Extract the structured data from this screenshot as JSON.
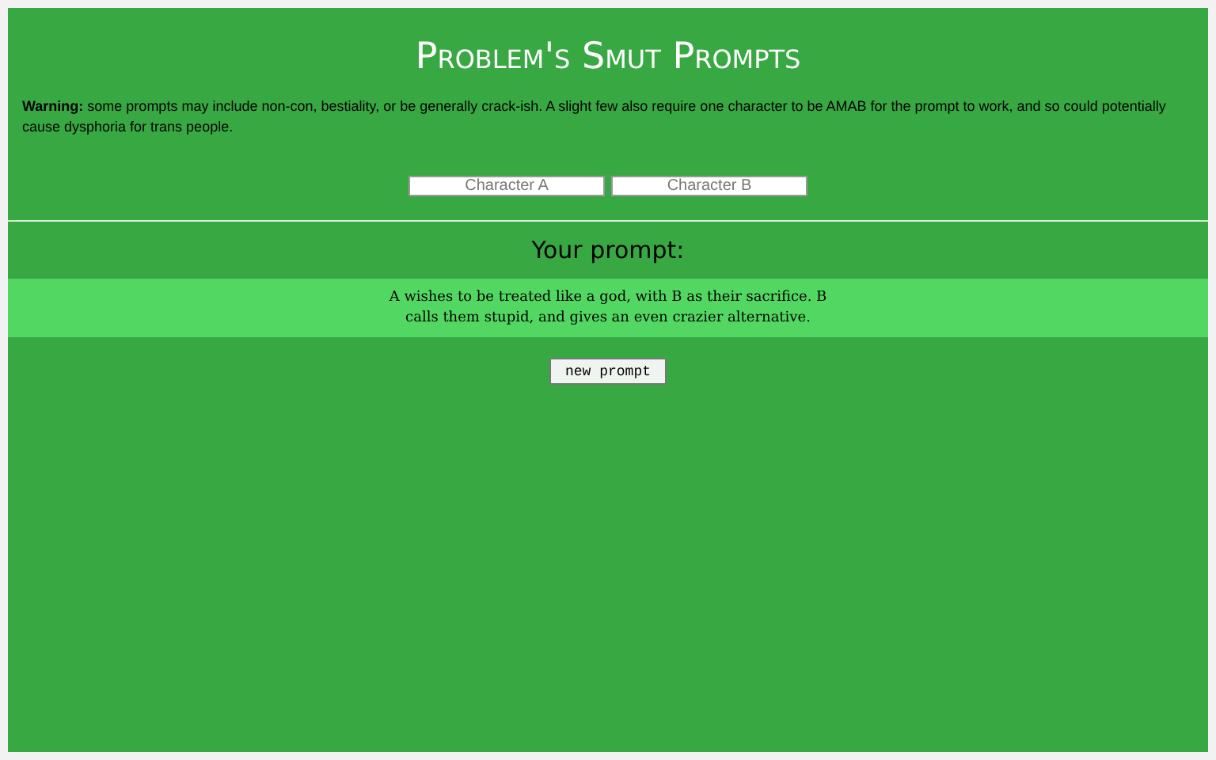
{
  "title": "Problem's Smut Prompts",
  "warning": "**Warning:** some prompts may include non-con, bestiality, or be generally crack-ish. A slight few also require one character to be AMAB for the prompt to work, and so could potentially cause dysphoria for trans people.",
  "fields": [
    {
      "placeholder": "Character A"
    },
    {
      "placeholder": "Character B"
    }
  ],
  "prompt_heading": "Your prompt:",
  "prompt": "A wishes to be treated like a god, with B as their sacrifice. B calls them stupid, and gives an even crazier alternative.",
  "button": "new prompt"
}
